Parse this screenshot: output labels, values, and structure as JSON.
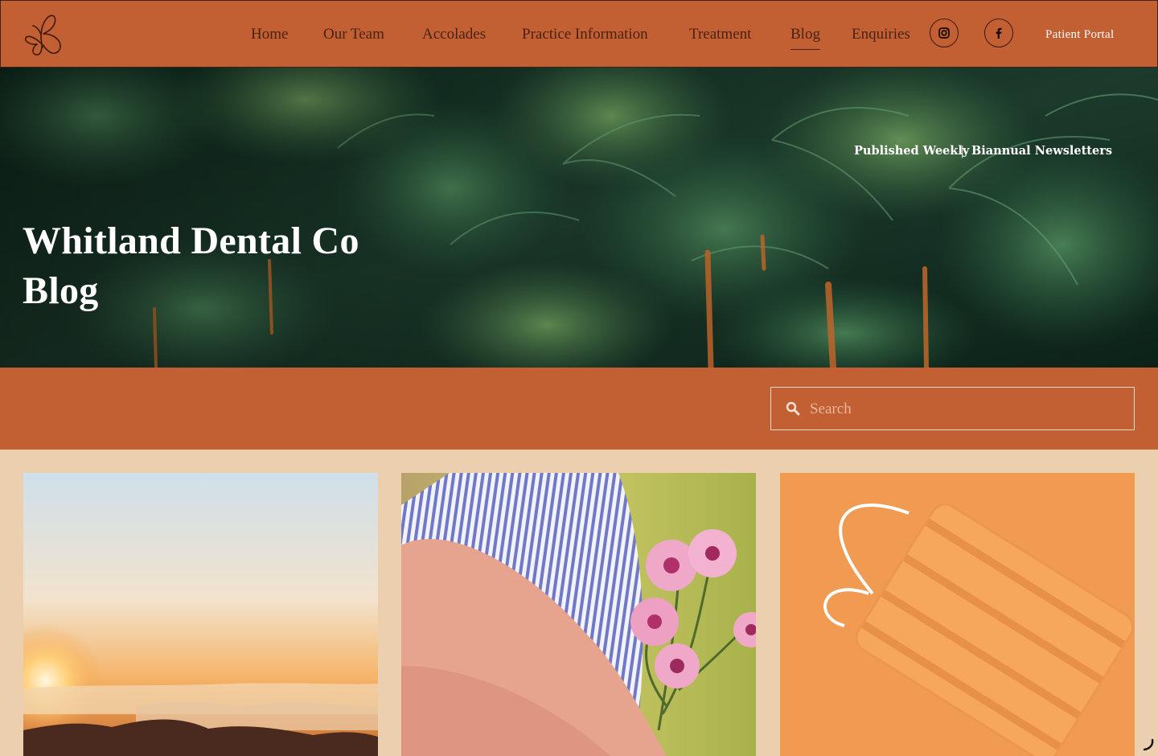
{
  "nav": {
    "links": [
      {
        "label": "Home"
      },
      {
        "label": "Our Team"
      },
      {
        "label": "Accolades"
      },
      {
        "label": "Practice Information"
      },
      {
        "label": "Treatment"
      },
      {
        "label": "Blog",
        "active": true
      },
      {
        "label": "Enquiries"
      }
    ],
    "social": [
      {
        "icon": "instagram-icon"
      },
      {
        "icon": "facebook-icon"
      }
    ],
    "portal_label": "Patient Portal",
    "logo_icon": "butterfly-icon"
  },
  "hero": {
    "tag_left": "Published Weekly",
    "tag_separator": "|",
    "tag_right": "Biannual Newsletters",
    "title_line1": "Whitland Dental Co",
    "title_line2": "Blog"
  },
  "search": {
    "placeholder": "Search",
    "value": ""
  },
  "colors": {
    "brand": "#c25f33",
    "page_bg": "#ebcfae",
    "nav_text": "#4a2210"
  }
}
